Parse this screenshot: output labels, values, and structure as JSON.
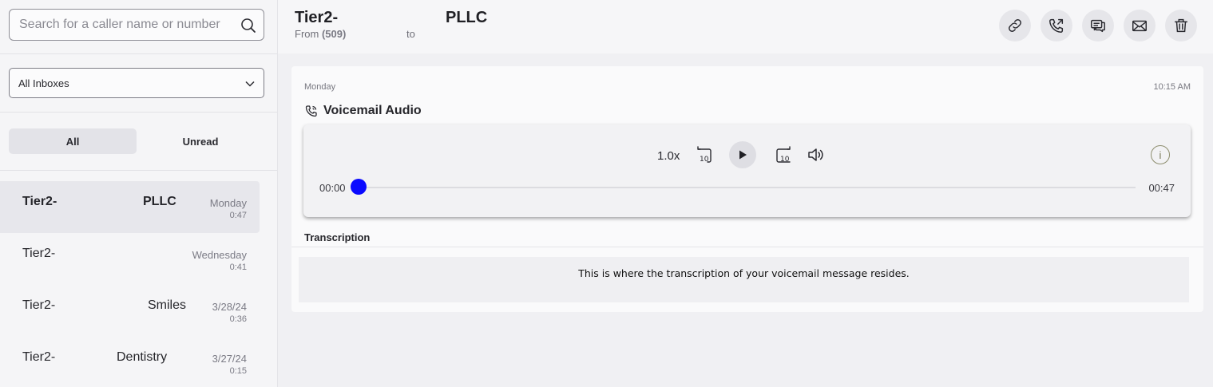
{
  "sidebar": {
    "search": {
      "placeholder": "Search for a caller name or number",
      "value": ""
    },
    "inbox_select": {
      "value": "All Inboxes"
    },
    "filter_tabs": [
      {
        "label": "All",
        "active": true
      },
      {
        "label": "Unread",
        "active": false
      }
    ],
    "messages": [
      {
        "name": "Tier2-",
        "org": "PLLC",
        "date": "Monday",
        "duration": "0:47",
        "selected": true
      },
      {
        "name": "Tier2-",
        "org": "",
        "date": "Wednesday",
        "duration": "0:41",
        "selected": false
      },
      {
        "name": "Tier2-",
        "org": "Smiles",
        "date": "3/28/24",
        "duration": "0:36",
        "selected": false
      },
      {
        "name": "Tier2-",
        "org": "Dentistry",
        "date": "3/27/24",
        "duration": "0:15",
        "selected": false
      }
    ]
  },
  "header": {
    "title": "Tier2-",
    "title_org": "PLLC",
    "from_label": "From",
    "from_number": "(509)",
    "to_label": "to",
    "actions": [
      {
        "name": "link-icon"
      },
      {
        "name": "call-back-icon"
      },
      {
        "name": "message-icon"
      },
      {
        "name": "email-icon"
      },
      {
        "name": "trash-icon"
      }
    ]
  },
  "card": {
    "day": "Monday",
    "time": "10:15 AM",
    "title": "Voicemail Audio",
    "player": {
      "speed": "1.0x",
      "current_time": "00:00",
      "total_time": "00:47",
      "progress": 0,
      "info_label": "i"
    },
    "transcription_label": "Transcription",
    "transcription_text": "This is where the transcription of your voicemail message resides."
  },
  "colors": {
    "accent": "#0a0aff",
    "selected_row": "#e7e7ec"
  }
}
